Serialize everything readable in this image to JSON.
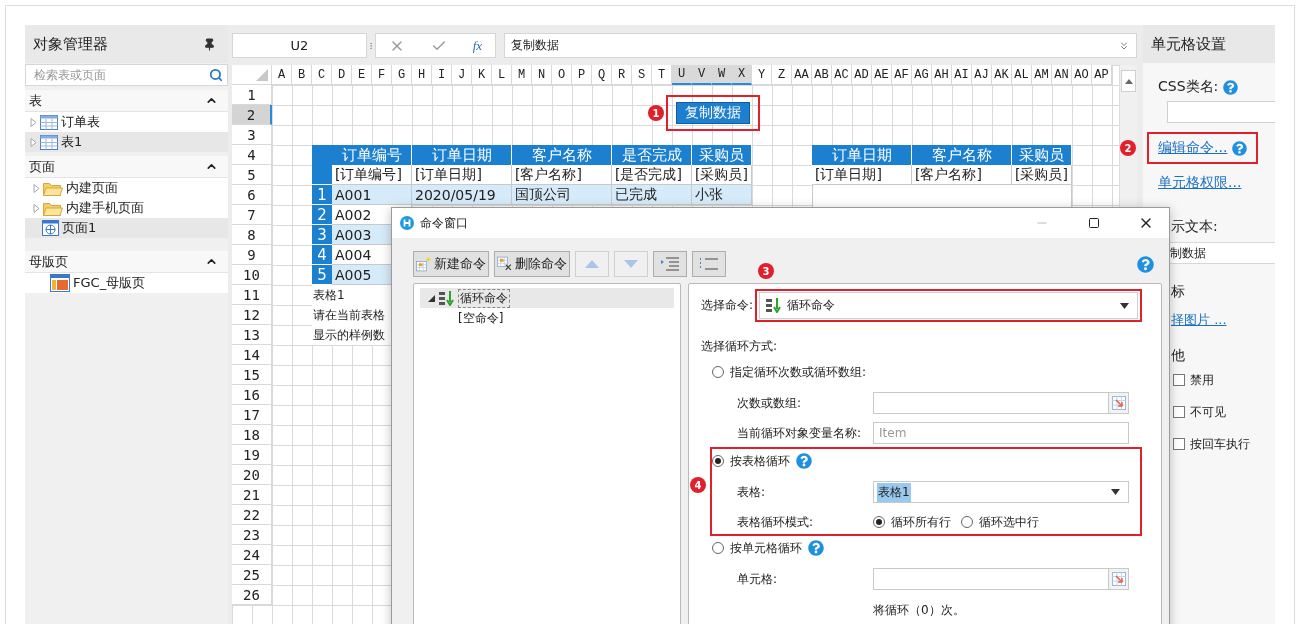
{
  "object_manager": {
    "title": "对象管理器",
    "search": {
      "placeholder": "检索表或页面"
    },
    "sections": [
      {
        "title": "表",
        "expanded": true,
        "items": [
          {
            "label": "订单表",
            "kind": "table",
            "expandable": true,
            "selected": false
          },
          {
            "label": "表1",
            "kind": "table",
            "expandable": true,
            "selected": true
          }
        ]
      },
      {
        "title": "页面",
        "expanded": true,
        "items": [
          {
            "label": "内建页面",
            "kind": "folder",
            "expandable": true,
            "selected": false
          },
          {
            "label": "内建手机页面",
            "kind": "folder",
            "expandable": true,
            "selected": false
          },
          {
            "label": "页面1",
            "kind": "page",
            "expandable": false,
            "selected": true
          }
        ]
      },
      {
        "title": "母版页",
        "expanded": true,
        "items": [
          {
            "label": "FGC_母版页",
            "kind": "master",
            "expandable": false,
            "selected": false
          }
        ]
      }
    ]
  },
  "formula_bar": {
    "cell": "U2",
    "function_label": "fx",
    "formula": "复制数据"
  },
  "sheet": {
    "columns": [
      {
        "label": "A",
        "selected": false
      },
      {
        "label": "B",
        "selected": false
      },
      {
        "label": "C",
        "selected": false
      },
      {
        "label": "D",
        "selected": false
      },
      {
        "label": "E",
        "selected": false
      },
      {
        "label": "F",
        "selected": false
      },
      {
        "label": "G",
        "selected": false
      },
      {
        "label": "H",
        "selected": false
      },
      {
        "label": "I",
        "selected": false
      },
      {
        "label": "J",
        "selected": false
      },
      {
        "label": "K",
        "selected": false
      },
      {
        "label": "L",
        "selected": false
      },
      {
        "label": "M",
        "selected": false
      },
      {
        "label": "N",
        "selected": false
      },
      {
        "label": "O",
        "selected": false
      },
      {
        "label": "P",
        "selected": false
      },
      {
        "label": "Q",
        "selected": false
      },
      {
        "label": "R",
        "selected": false
      },
      {
        "label": "S",
        "selected": false
      },
      {
        "label": "T",
        "selected": false
      },
      {
        "label": "U",
        "selected": true
      },
      {
        "label": "V",
        "selected": true
      },
      {
        "label": "W",
        "selected": true
      },
      {
        "label": "X",
        "selected": true
      },
      {
        "label": "Y",
        "selected": false
      },
      {
        "label": "Z",
        "selected": false
      },
      {
        "label": "AA",
        "selected": false
      },
      {
        "label": "AB",
        "selected": false
      },
      {
        "label": "AC",
        "selected": false
      },
      {
        "label": "AD",
        "selected": false
      },
      {
        "label": "AE",
        "selected": false
      },
      {
        "label": "AF",
        "selected": false
      },
      {
        "label": "AG",
        "selected": false
      },
      {
        "label": "AH",
        "selected": false
      },
      {
        "label": "AI",
        "selected": false
      },
      {
        "label": "AJ",
        "selected": false
      },
      {
        "label": "AK",
        "selected": false
      },
      {
        "label": "AL",
        "selected": false
      },
      {
        "label": "AM",
        "selected": false
      },
      {
        "label": "AN",
        "selected": false
      },
      {
        "label": "AO",
        "selected": false
      },
      {
        "label": "AP",
        "selected": false
      }
    ],
    "rows": [
      {
        "label": "1",
        "selected": false
      },
      {
        "label": "2",
        "selected": true
      },
      {
        "label": "3",
        "selected": false
      },
      {
        "label": "4",
        "selected": false
      },
      {
        "label": "5",
        "selected": false
      },
      {
        "label": "6",
        "selected": false
      },
      {
        "label": "7",
        "selected": false
      },
      {
        "label": "8",
        "selected": false
      },
      {
        "label": "9",
        "selected": false
      },
      {
        "label": "10",
        "selected": false
      },
      {
        "label": "11",
        "selected": false
      },
      {
        "label": "12",
        "selected": false
      },
      {
        "label": "13",
        "selected": false
      },
      {
        "label": "14",
        "selected": false
      },
      {
        "label": "15",
        "selected": false
      },
      {
        "label": "16",
        "selected": false
      },
      {
        "label": "17",
        "selected": false
      },
      {
        "label": "18",
        "selected": false
      },
      {
        "label": "19",
        "selected": false
      },
      {
        "label": "20",
        "selected": false
      },
      {
        "label": "21",
        "selected": false
      },
      {
        "label": "22",
        "selected": false
      },
      {
        "label": "23",
        "selected": false
      },
      {
        "label": "24",
        "selected": false
      },
      {
        "label": "25",
        "selected": false
      },
      {
        "label": "26",
        "selected": false
      }
    ],
    "action_button": {
      "label": "复制数据",
      "badge": "1"
    },
    "table_1": {
      "headers": [
        "订单编号",
        "订单日期",
        "客户名称",
        "是否完成",
        "采购员"
      ],
      "fields": [
        "[订单编号]",
        "[订单日期]",
        "[客户名称]",
        "[是否完成]",
        "[采购员]"
      ],
      "rows": [
        {
          "index": "1",
          "cells": [
            "A001",
            "2020/05/19",
            "国顶公司",
            "已完成",
            "小张"
          ],
          "highlighted": true
        },
        {
          "index": "2",
          "cells": [
            "A002"
          ],
          "highlighted": false
        },
        {
          "index": "3",
          "cells": [
            "A003"
          ],
          "highlighted": true
        },
        {
          "index": "4",
          "cells": [
            "A004"
          ],
          "highlighted": false
        },
        {
          "index": "5",
          "cells": [
            "A005"
          ],
          "highlighted": true
        }
      ]
    },
    "table_2": {
      "headers": [
        "订单日期",
        "客户名称",
        "采购员"
      ],
      "fields": [
        "[订单日期]",
        "[客户名称]",
        "[采购员]"
      ]
    },
    "notes": [
      "表格1",
      "请在当前表格",
      "显示的样例数"
    ]
  },
  "cell_settings": {
    "title": "单元格设置",
    "css_class_label": "CSS类名:",
    "edit_command": {
      "label": "编辑命令...",
      "badge": "2"
    },
    "permissions": "单元格权限...",
    "display_text_label": "示文本:",
    "display_text": "制数据",
    "icon_label": "标",
    "choose_image": "择图片 ...",
    "other_label": "他",
    "options": [
      {
        "label": "禁用",
        "checked": false
      },
      {
        "label": "不可见",
        "checked": false
      },
      {
        "label": "按回车执行",
        "checked": false
      }
    ]
  },
  "dialog": {
    "title": "命令窗口",
    "toolbar": [
      {
        "kind": "new",
        "label": "新建命令",
        "disabled": false
      },
      {
        "kind": "delete",
        "label": "删除命令",
        "disabled": false
      },
      {
        "kind": "up",
        "disabled": true
      },
      {
        "kind": "down",
        "disabled": true
      },
      {
        "kind": "indent",
        "disabled": false
      },
      {
        "kind": "outdent",
        "disabled": false
      }
    ],
    "tree": [
      {
        "label": "循环命令",
        "kind": "loop",
        "expanded": true,
        "selected": true,
        "children": [
          {
            "label": "[空命令]",
            "selected": false
          }
        ]
      }
    ],
    "command": {
      "label": "选择命令:",
      "value": "循环命令",
      "badge": "3"
    },
    "mode_label": "选择循环方式:",
    "modes": [
      {
        "label": "指定循环次数或循环数组:",
        "selected": false,
        "fields": [
          {
            "label": "次数或数组:",
            "kind": "picker"
          },
          {
            "label": "当前循环对象变量名称:",
            "kind": "text",
            "placeholder": "Item"
          }
        ]
      },
      {
        "label": "按表格循环",
        "selected": true,
        "help": true,
        "badge": "4",
        "fields": [
          {
            "label": "表格:",
            "kind": "select",
            "value": "表格1"
          },
          {
            "label": "表格循环模式:",
            "kind": "radios",
            "options": [
              {
                "label": "循环所有行",
                "selected": true
              },
              {
                "label": "循环选中行",
                "selected": false
              }
            ]
          }
        ]
      },
      {
        "label": "按单元格循环",
        "selected": false,
        "help": true,
        "fields": [
          {
            "label": "单元格:",
            "kind": "picker"
          }
        ]
      }
    ],
    "summary": "将循环（0）次。"
  }
}
